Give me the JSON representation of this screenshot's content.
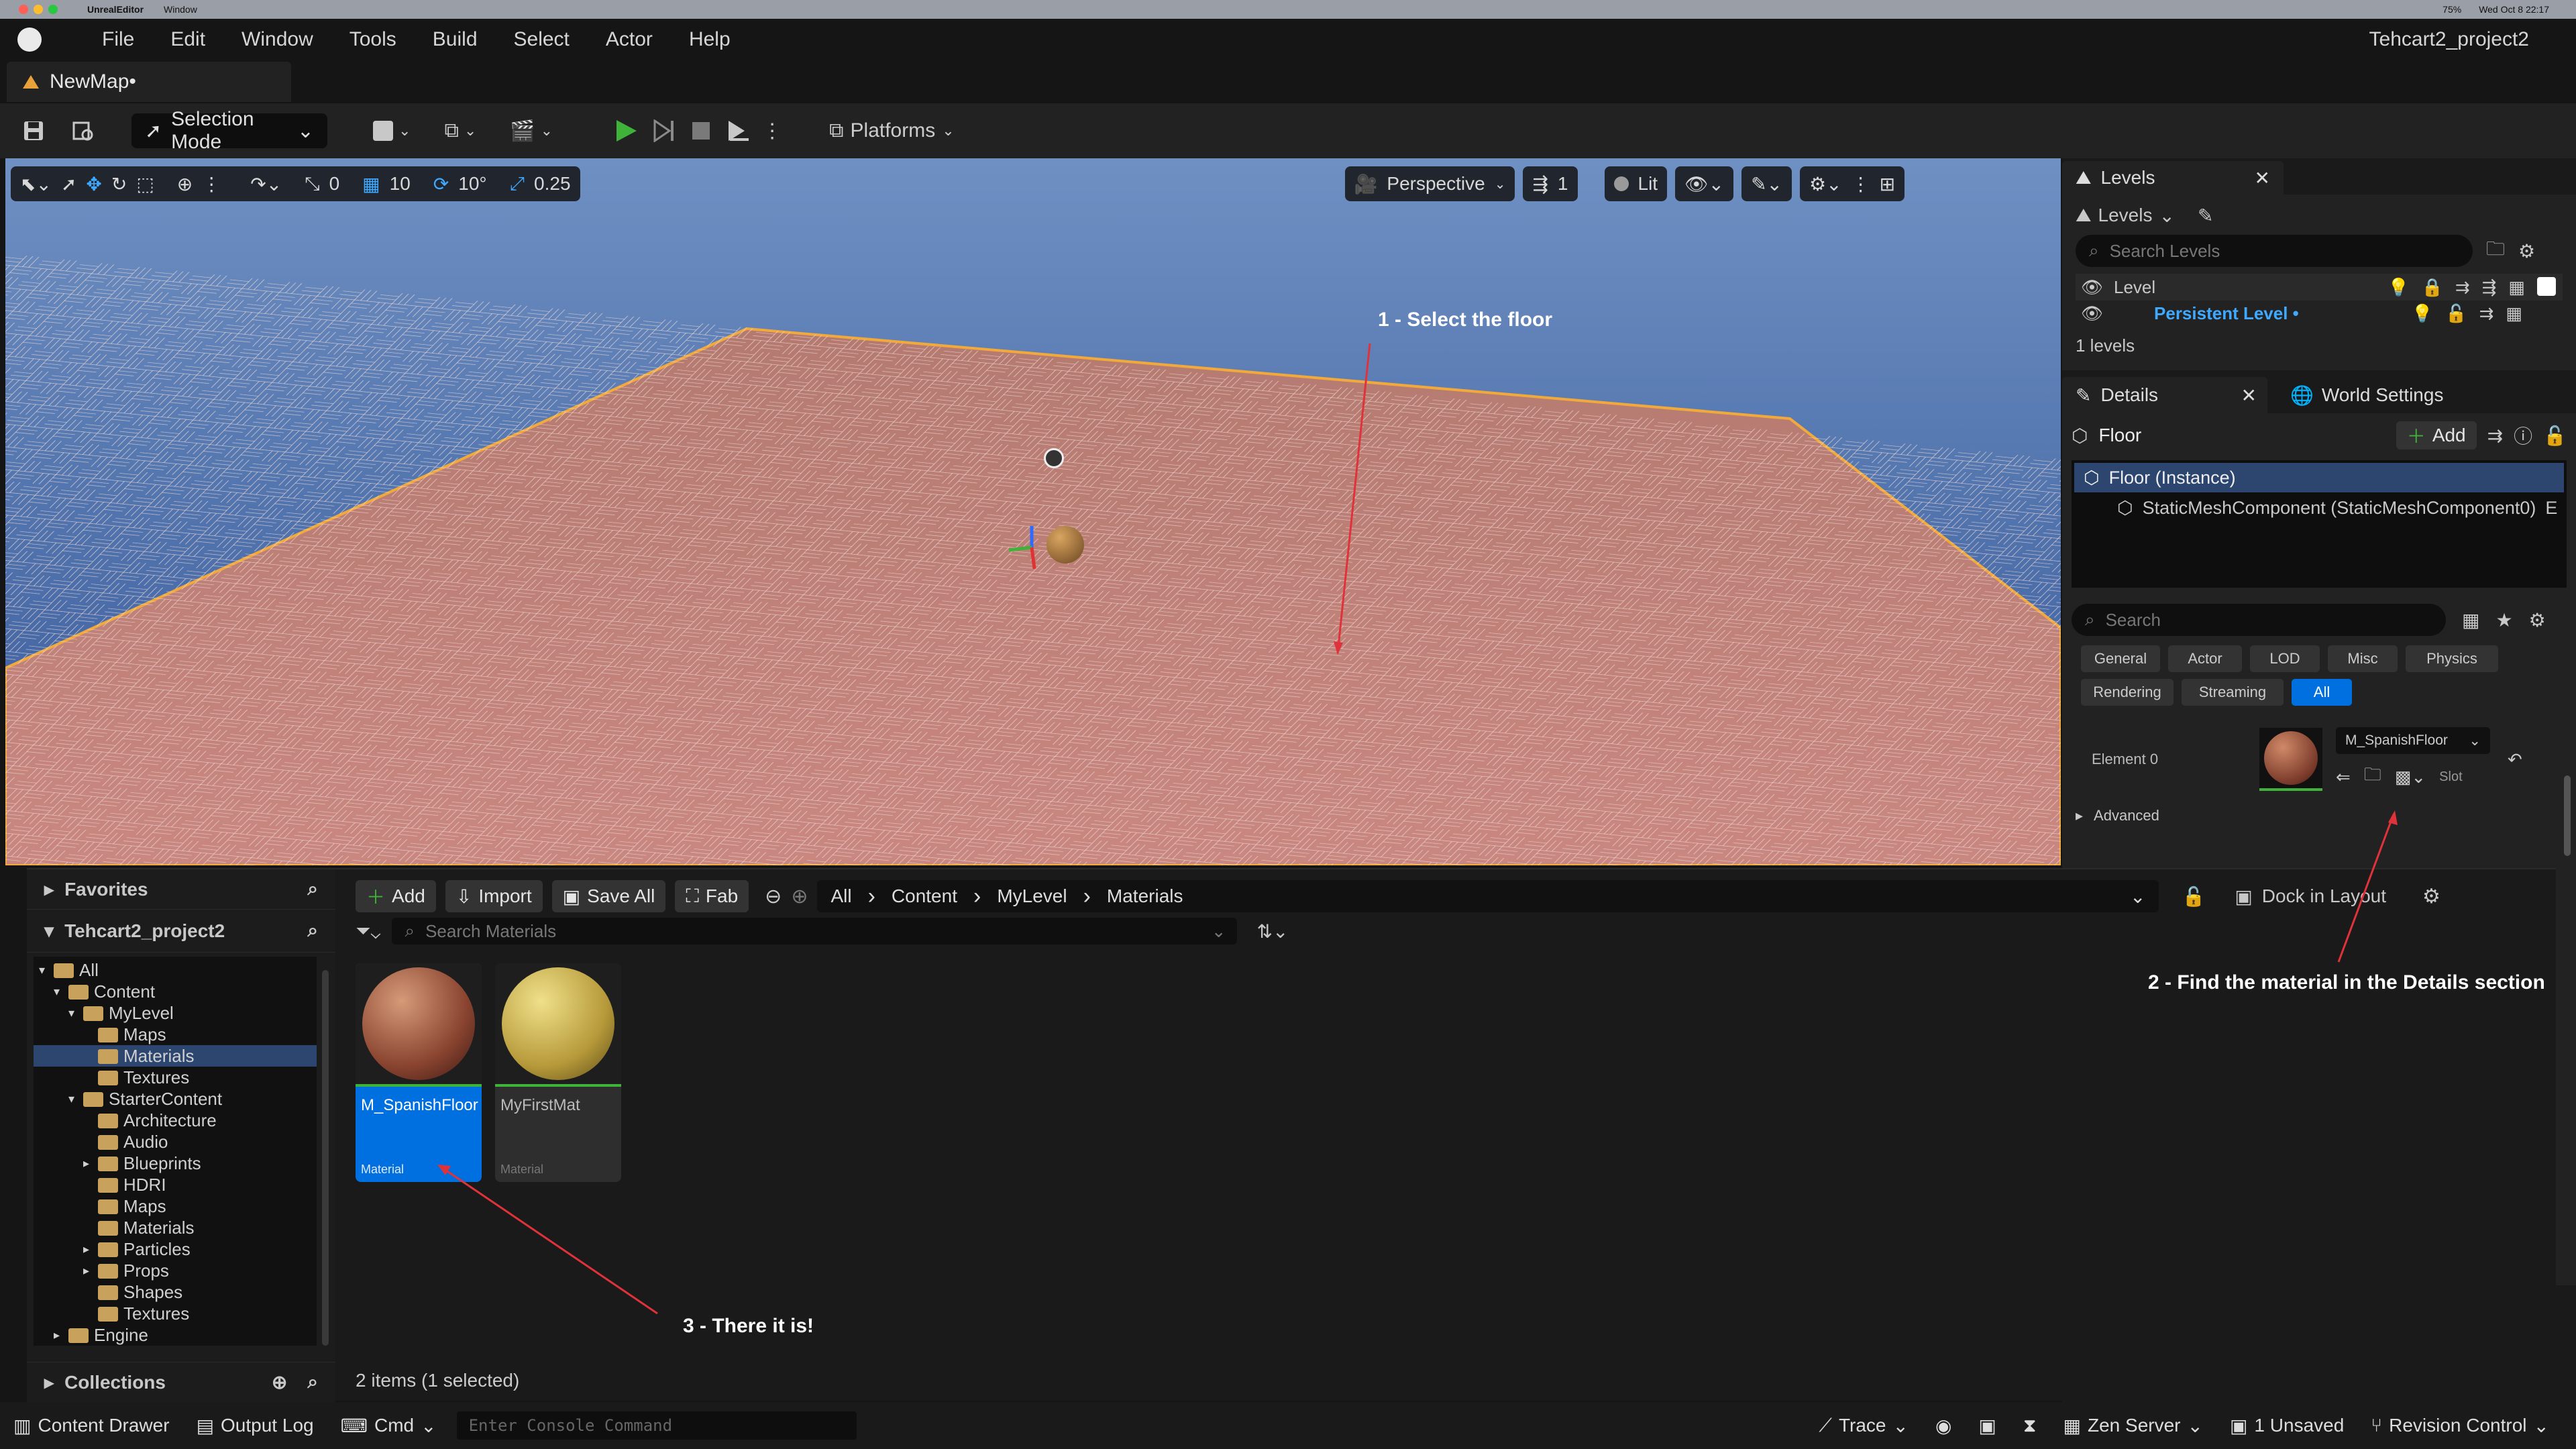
{
  "mac_bar": {
    "app": "UnrealEditor",
    "menu": "Window",
    "datetime": "Wed Oct 8  22:17",
    "battery": "75%"
  },
  "menu": [
    "File",
    "Edit",
    "Window",
    "Tools",
    "Build",
    "Select",
    "Actor",
    "Help"
  ],
  "project_name": "Tehcart2_project2",
  "map_tab": "NewMap•",
  "toolbar": {
    "selection_mode": "Selection Mode",
    "platforms": "Platforms"
  },
  "viewport_toolbar": {
    "angle_snap": "0",
    "grid_snap": "10",
    "rotation_snap": "10°",
    "scale_snap": "0.25",
    "perspective": "Perspective",
    "camera_speed": "1",
    "view_mode": "Lit"
  },
  "annotations": {
    "step1": "1 - Select the floor",
    "step2": "2 - Find the material in the Details section",
    "step3": "3 - There it is!"
  },
  "levels_panel": {
    "tab": "Levels",
    "dropdown": "Levels",
    "search_placeholder": "Search Levels",
    "column": "Level",
    "persistent_level": "Persistent Level •",
    "count": "1 levels"
  },
  "details_panel": {
    "tab": "Details",
    "world_settings_tab": "World Settings",
    "actor_name": "Floor",
    "add_button": "Add",
    "instance": "Floor (Instance)",
    "component": "StaticMeshComponent (StaticMeshComponent0)",
    "component_suffix": "E",
    "search_placeholder": "Search",
    "filters": [
      "General",
      "Actor",
      "LOD",
      "Misc",
      "Physics",
      "Rendering",
      "Streaming",
      "All"
    ],
    "active_filter": "All",
    "element_label": "Element 0",
    "material": "M_SpanishFloor",
    "slot_label": "Slot",
    "advanced": "Advanced"
  },
  "content_browser": {
    "favorites": "Favorites",
    "project": "Tehcart2_project2",
    "collections": "Collections",
    "tree": [
      {
        "label": "All",
        "depth": 0,
        "arrow": "down"
      },
      {
        "label": "Content",
        "depth": 1,
        "arrow": "down"
      },
      {
        "label": "MyLevel",
        "depth": 2,
        "arrow": "down"
      },
      {
        "label": "Maps",
        "depth": 3,
        "arrow": ""
      },
      {
        "label": "Materials",
        "depth": 3,
        "arrow": "",
        "selected": true
      },
      {
        "label": "Textures",
        "depth": 3,
        "arrow": ""
      },
      {
        "label": "StarterContent",
        "depth": 2,
        "arrow": "down"
      },
      {
        "label": "Architecture",
        "depth": 3,
        "arrow": ""
      },
      {
        "label": "Audio",
        "depth": 3,
        "arrow": ""
      },
      {
        "label": "Blueprints",
        "depth": 3,
        "arrow": "right"
      },
      {
        "label": "HDRI",
        "depth": 3,
        "arrow": ""
      },
      {
        "label": "Maps",
        "depth": 3,
        "arrow": ""
      },
      {
        "label": "Materials",
        "depth": 3,
        "arrow": ""
      },
      {
        "label": "Particles",
        "depth": 3,
        "arrow": "right"
      },
      {
        "label": "Props",
        "depth": 3,
        "arrow": "right"
      },
      {
        "label": "Shapes",
        "depth": 3,
        "arrow": ""
      },
      {
        "label": "Textures",
        "depth": 3,
        "arrow": ""
      },
      {
        "label": "Engine",
        "depth": 1,
        "arrow": "right"
      }
    ],
    "add": "Add",
    "import": "Import",
    "save_all": "Save All",
    "fab": "Fab",
    "breadcrumb": [
      "All",
      "Content",
      "MyLevel",
      "Materials"
    ],
    "dock_in_layout": "Dock in Layout",
    "search_placeholder": "Search Materials",
    "assets": [
      {
        "name": "M_SpanishFloor",
        "type": "Material",
        "selected": true
      },
      {
        "name": "MyFirstMat",
        "type": "Material",
        "selected": false
      }
    ],
    "item_count": "2 items (1 selected)"
  },
  "status_bar": {
    "content_drawer": "Content Drawer",
    "output_log": "Output Log",
    "cmd": "Cmd",
    "console_placeholder": "Enter Console Command",
    "trace": "Trace",
    "zen_server": "Zen Server",
    "unsaved": "1 Unsaved",
    "revision_control": "Revision Control"
  },
  "colors": {
    "accent": "#0070e0",
    "persistent_level": "#3fa9ff",
    "play": "#3fb23a",
    "annotation_arrow": "#e0323a"
  }
}
